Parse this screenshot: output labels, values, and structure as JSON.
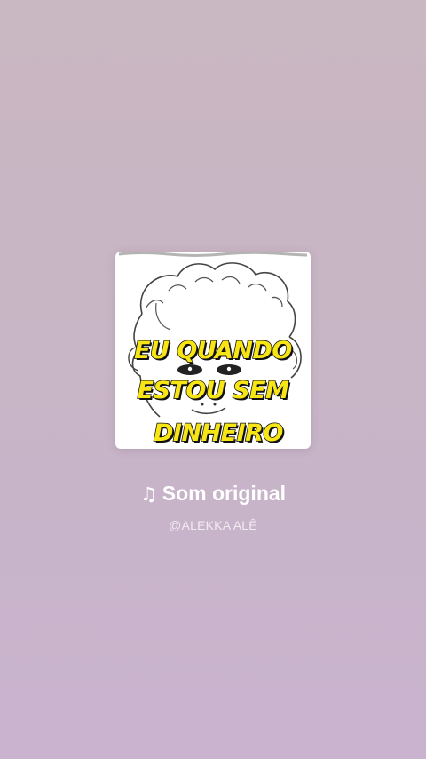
{
  "sound": {
    "title": "Som original",
    "note_icon": "♫",
    "author": "@ALEKKA ALÊ"
  },
  "cover": {
    "text_lines": [
      "EU QUANDO",
      "ESTOU SEM",
      "DINHEIRO"
    ],
    "text_color": "#f7e516",
    "outline_color": "#111111"
  }
}
